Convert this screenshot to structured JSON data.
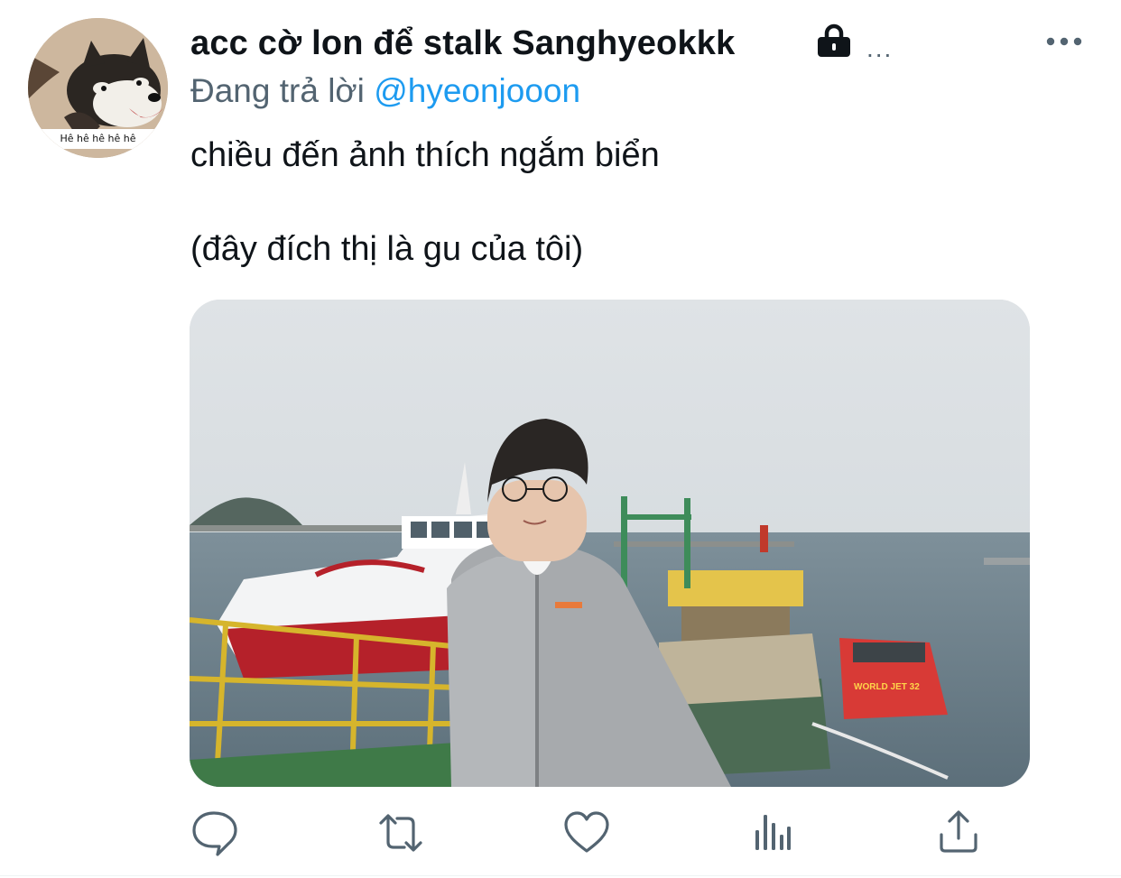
{
  "tweet": {
    "display_name": "acc cờ lon để stalk Sanghyeokkk",
    "name_overflow": "...",
    "protected_icon": "lock-icon",
    "reply_prefix": "Đang trả lời",
    "reply_handle": "@hyeonjooon",
    "text": "chiều đến ảnh thích ngắm biển\n\n(đây đích thị là gu của tôi)",
    "avatar_caption": "Hê hê hê hê hê",
    "media_boat_label": "WORLD JET 32",
    "more_icon": "more-horizontal-icon"
  },
  "actions": [
    {
      "name": "reply",
      "icon": "comment-bubble-icon"
    },
    {
      "name": "retweet",
      "icon": "retweet-icon"
    },
    {
      "name": "like",
      "icon": "heart-icon"
    },
    {
      "name": "analytics",
      "icon": "bar-chart-icon"
    },
    {
      "name": "share",
      "icon": "share-upload-icon"
    }
  ],
  "colors": {
    "text_primary": "#0f1419",
    "text_secondary": "#536471",
    "link": "#1d9bf0"
  }
}
